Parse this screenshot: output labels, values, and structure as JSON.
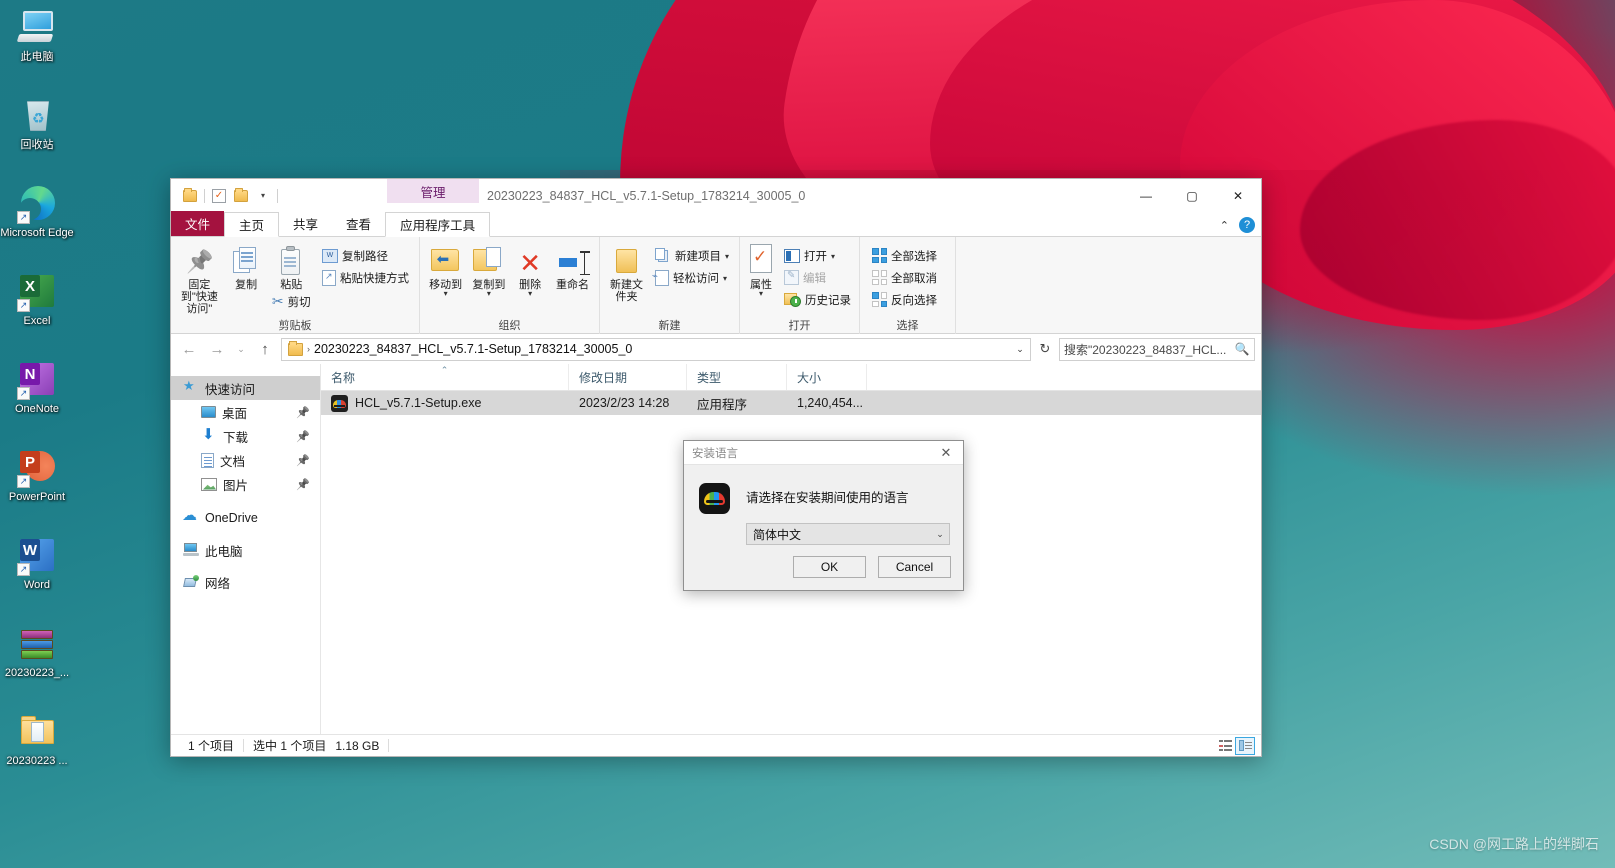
{
  "desktop": {
    "icons": [
      {
        "label": "此电脑",
        "icon": "this-pc-icon"
      },
      {
        "label": "回收站",
        "icon": "recycle-bin-icon"
      },
      {
        "label": "Microsoft Edge",
        "icon": "microsoft-edge-icon"
      },
      {
        "label": "Excel",
        "icon": "excel-icon"
      },
      {
        "label": "OneNote",
        "icon": "onenote-icon"
      },
      {
        "label": "PowerPoint",
        "icon": "powerpoint-icon"
      },
      {
        "label": "Word",
        "icon": "word-icon"
      },
      {
        "label": "20230223_...",
        "icon": "winrar-archive-icon"
      },
      {
        "label": "20230223 ...",
        "icon": "folder-icon"
      }
    ],
    "watermark": "CSDN @网工路上的绊脚石"
  },
  "explorer": {
    "title": "20230223_84837_HCL_v5.7.1-Setup_1783214_30005_0",
    "contextual_tab": "管理",
    "quick_access_toolbar": [
      {
        "name": "folder-icon"
      },
      {
        "name": "properties-check-icon"
      },
      {
        "name": "new-folder-icon"
      },
      {
        "name": "customize-caret-icon"
      }
    ],
    "window_controls": {
      "minimize": "—",
      "maximize": "▢",
      "close": "✕"
    },
    "ribbon_right": {
      "collapse": "⌃",
      "help": "?"
    },
    "tabs": [
      {
        "label": "文件",
        "state": "file"
      },
      {
        "label": "主页",
        "state": "active"
      },
      {
        "label": "共享",
        "state": "normal"
      },
      {
        "label": "查看",
        "state": "normal"
      },
      {
        "label": "应用程序工具",
        "state": "contextual"
      }
    ],
    "ribbon": {
      "groups": [
        {
          "title": "剪贴板",
          "big_buttons": [
            {
              "label": "固定到\"快速访问\"",
              "icon": "pin-icon"
            },
            {
              "label": "复制",
              "icon": "copy-icon"
            },
            {
              "label": "粘贴",
              "icon": "paste-icon"
            }
          ],
          "small_buttons": [
            {
              "label": "复制路径",
              "icon": "copy-path-icon"
            },
            {
              "label": "粘贴快捷方式",
              "icon": "paste-shortcut-icon"
            },
            {
              "label": "剪切",
              "icon": "scissors-icon"
            }
          ]
        },
        {
          "title": "组织",
          "big_buttons": [
            {
              "label": "移动到",
              "icon": "move-to-icon",
              "dropdown": true
            },
            {
              "label": "复制到",
              "icon": "copy-to-icon",
              "dropdown": true
            },
            {
              "label": "删除",
              "icon": "delete-icon",
              "dropdown": true
            },
            {
              "label": "重命名",
              "icon": "rename-icon"
            }
          ]
        },
        {
          "title": "新建",
          "big_buttons": [
            {
              "label": "新建文件夹",
              "icon": "new-folder-icon"
            }
          ],
          "small_buttons": [
            {
              "label": "新建项目",
              "icon": "new-item-icon",
              "dropdown": true
            },
            {
              "label": "轻松访问",
              "icon": "easy-access-icon",
              "dropdown": true
            }
          ]
        },
        {
          "title": "打开",
          "big_buttons": [
            {
              "label": "属性",
              "icon": "properties-icon",
              "dropdown": true
            }
          ],
          "small_buttons": [
            {
              "label": "打开",
              "icon": "open-icon",
              "dropdown": true
            },
            {
              "label": "编辑",
              "icon": "edit-icon",
              "disabled": true
            },
            {
              "label": "历史记录",
              "icon": "history-icon"
            }
          ]
        },
        {
          "title": "选择",
          "small_buttons": [
            {
              "label": "全部选择",
              "icon": "select-all-icon"
            },
            {
              "label": "全部取消",
              "icon": "select-none-icon"
            },
            {
              "label": "反向选择",
              "icon": "invert-selection-icon"
            }
          ]
        }
      ]
    },
    "address_bar": {
      "back": "←",
      "forward": "→",
      "recent": "⌄",
      "up": "↑",
      "path": "20230223_84837_HCL_v5.7.1-Setup_1783214_30005_0",
      "dropdown": "⌄",
      "refresh": "↻",
      "search_value": "搜索\"20230223_84837_HCL...",
      "search_icon": "🔍"
    },
    "nav_pane": [
      {
        "label": "快速访问",
        "icon": "quick-access-star-icon",
        "selected": true,
        "indent": false,
        "pinned": false
      },
      {
        "label": "桌面",
        "icon": "desktop-icon",
        "selected": false,
        "indent": true,
        "pinned": true
      },
      {
        "label": "下载",
        "icon": "downloads-icon",
        "selected": false,
        "indent": true,
        "pinned": true
      },
      {
        "label": "文档",
        "icon": "documents-icon",
        "selected": false,
        "indent": true,
        "pinned": true
      },
      {
        "label": "图片",
        "icon": "pictures-icon",
        "selected": false,
        "indent": true,
        "pinned": true
      },
      {
        "label": "OneDrive",
        "icon": "onedrive-cloud-icon",
        "selected": false,
        "indent": false,
        "pinned": false
      },
      {
        "label": "此电脑",
        "icon": "this-pc-icon",
        "selected": false,
        "indent": false,
        "pinned": false
      },
      {
        "label": "网络",
        "icon": "network-icon",
        "selected": false,
        "indent": false,
        "pinned": false
      }
    ],
    "columns": [
      {
        "key": "name",
        "label": "名称",
        "sorted": true
      },
      {
        "key": "date",
        "label": "修改日期",
        "sorted": false
      },
      {
        "key": "type",
        "label": "类型",
        "sorted": false
      },
      {
        "key": "size",
        "label": "大小",
        "sorted": false
      }
    ],
    "rows": [
      {
        "name": "HCL_v5.7.1-Setup.exe",
        "date": "2023/2/23 14:28",
        "type": "应用程序",
        "size": "1,240,454...",
        "icon": "hcl-setup-exe-icon",
        "selected": true
      }
    ],
    "status_bar": {
      "item_count": "1 个项目",
      "selection": "选中 1 个项目",
      "selection_size": "1.18 GB",
      "views": [
        {
          "name": "details-view-button",
          "active": false
        },
        {
          "name": "large-icons-view-button",
          "active": true
        }
      ]
    }
  },
  "dialog": {
    "title": "安装语言",
    "close": "✕",
    "message": "请选择在安装期间使用的语言",
    "app_icon": "hcl-cloud-icon",
    "language_value": "简体中文",
    "language_caret": "⌄",
    "buttons": [
      {
        "label": "OK",
        "name": "ok-button"
      },
      {
        "label": "Cancel",
        "name": "cancel-button"
      }
    ]
  }
}
